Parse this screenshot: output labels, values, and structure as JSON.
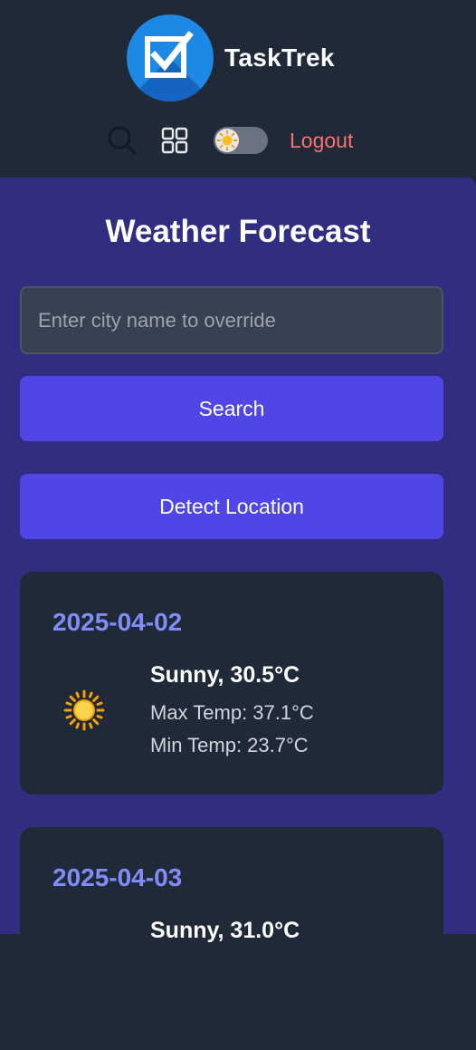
{
  "app": {
    "name": "TaskTrek"
  },
  "toolbar": {
    "search_icon": "search-icon",
    "grid_icon": "grid-icon",
    "theme_toggle_icon": "sun-icon",
    "logout_label": "Logout"
  },
  "weather": {
    "title": "Weather Forecast",
    "city_placeholder": "Enter city name to override",
    "search_label": "Search",
    "detect_label": "Detect Location",
    "forecasts": [
      {
        "date": "2025-04-02",
        "condition": "Sunny, 30.5°C",
        "max": "Max Temp: 37.1°C",
        "min": "Min Temp: 23.7°C",
        "icon": "sun-icon"
      },
      {
        "date": "2025-04-03",
        "condition": "Sunny, 31.0°C",
        "icon": "sun-icon"
      }
    ]
  },
  "colors": {
    "header_bg": "#1f2937",
    "main_bg": "#312e81",
    "button_bg": "#4f46e5",
    "card_bg": "#1f2937",
    "date_color": "#818cf8",
    "logout_color": "#f87171"
  }
}
